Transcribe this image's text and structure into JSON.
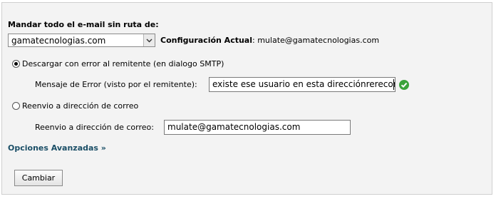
{
  "form": {
    "heading": "Mandar todo el e-mail sin ruta de:",
    "domain_select": {
      "value": "gamatecnologias.com"
    },
    "current_config": {
      "label": "Configuración Actual",
      "separator": ":",
      "value": "mulate@gamatecnologias.com"
    },
    "option_bounce": {
      "label": "Descargar con error al remitente (en dialogo SMTP)",
      "checked": true,
      "field_label": "Mensaje de Error (visto por el remitente):",
      "field_value": "existe ese usuario en esta direcciónrerecor"
    },
    "option_forward": {
      "label": "Reenvio a dirección de correo",
      "checked": false,
      "field_label": "Reenvio a dirección de correo:",
      "field_value": "mulate@gamatecnologias.com"
    },
    "advanced_link": "Opciones Avanzadas »",
    "submit_label": "Cambiar"
  },
  "icons": {
    "select_arrow": "chevron-down-icon",
    "valid": "check-circle-icon"
  },
  "colors": {
    "link": "#1a4e66",
    "ok_icon": "#3aa33a"
  }
}
